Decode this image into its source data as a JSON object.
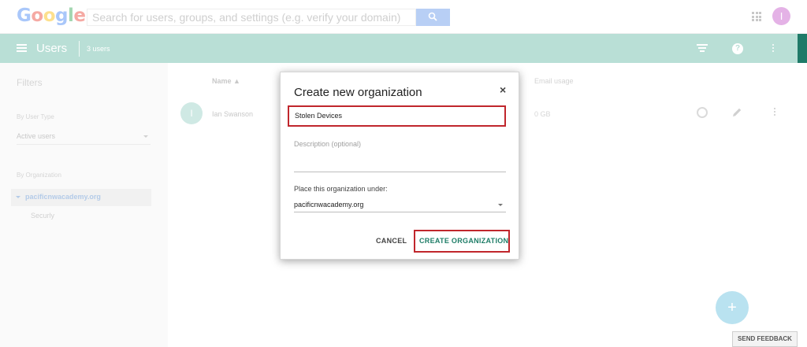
{
  "topbar": {
    "logo_letters": [
      "G",
      "o",
      "o",
      "g",
      "l",
      "e"
    ],
    "search_placeholder": "Search for users, groups, and settings (e.g. verify your domain)",
    "avatar_initial": "I"
  },
  "header": {
    "title": "Users",
    "count": "3 users",
    "color": "#b9dfd6"
  },
  "filters": {
    "title": "Filters",
    "user_type_label": "By User Type",
    "user_type_value": "Active users",
    "org_label": "By Organization",
    "org_root": "pacificnwacademy.org",
    "org_child": "Securly"
  },
  "table": {
    "columns": {
      "name": "Name",
      "email_usage": "Email usage"
    },
    "rows": [
      {
        "initial": "I",
        "name": "Ian Swanson",
        "email_usage": "0 GB"
      }
    ]
  },
  "dialog": {
    "title": "Create new organization",
    "close_symbol": "×",
    "name_value": "Stolen Devices",
    "description_placeholder": "Description (optional)",
    "place_label": "Place this organization under:",
    "place_value": "pacificnwacademy.org",
    "cancel_label": "CANCEL",
    "create_label": "CREATE ORGANIZATION",
    "highlight_color": "#c0262c",
    "accent_color": "#1e7d67"
  },
  "fab_symbol": "+",
  "feedback_label": "SEND FEEDBACK"
}
